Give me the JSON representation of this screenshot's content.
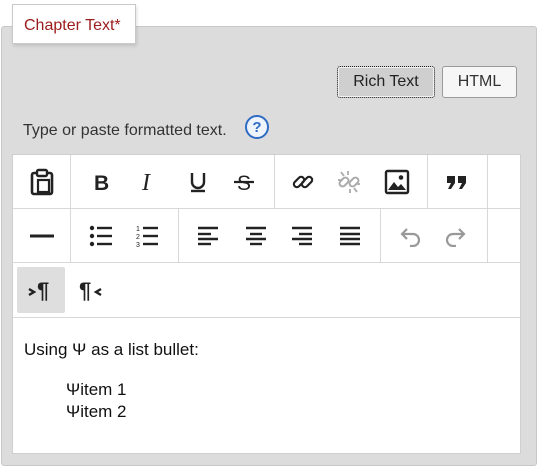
{
  "field": {
    "label": "Chapter Text*"
  },
  "mode": {
    "rich_text": "Rich Text",
    "html": "HTML"
  },
  "hint": {
    "text": "Type or paste formatted text.",
    "help": "?"
  },
  "toolbar": {
    "row1": [
      "paste-icon",
      "bold-icon",
      "italic-icon",
      "underline-icon",
      "strikethrough-icon",
      "link-icon",
      "unlink-icon",
      "image-icon",
      "blockquote-icon"
    ],
    "row2": [
      "horizontal-rule-icon",
      "bulleted-list-icon",
      "numbered-list-icon",
      "align-left-icon",
      "align-center-icon",
      "align-right-icon",
      "justify-icon",
      "undo-icon",
      "redo-icon"
    ],
    "row3": [
      "ltr-paragraph-icon",
      "rtl-paragraph-icon"
    ]
  },
  "content": {
    "paragraph": "Using Ψ as a list bullet:",
    "items": [
      "Ψitem 1",
      "Ψitem 2"
    ]
  },
  "colors": {
    "label": "#9b1c1c",
    "help": "#2d6bc4",
    "panel": "#dcdcdc"
  }
}
